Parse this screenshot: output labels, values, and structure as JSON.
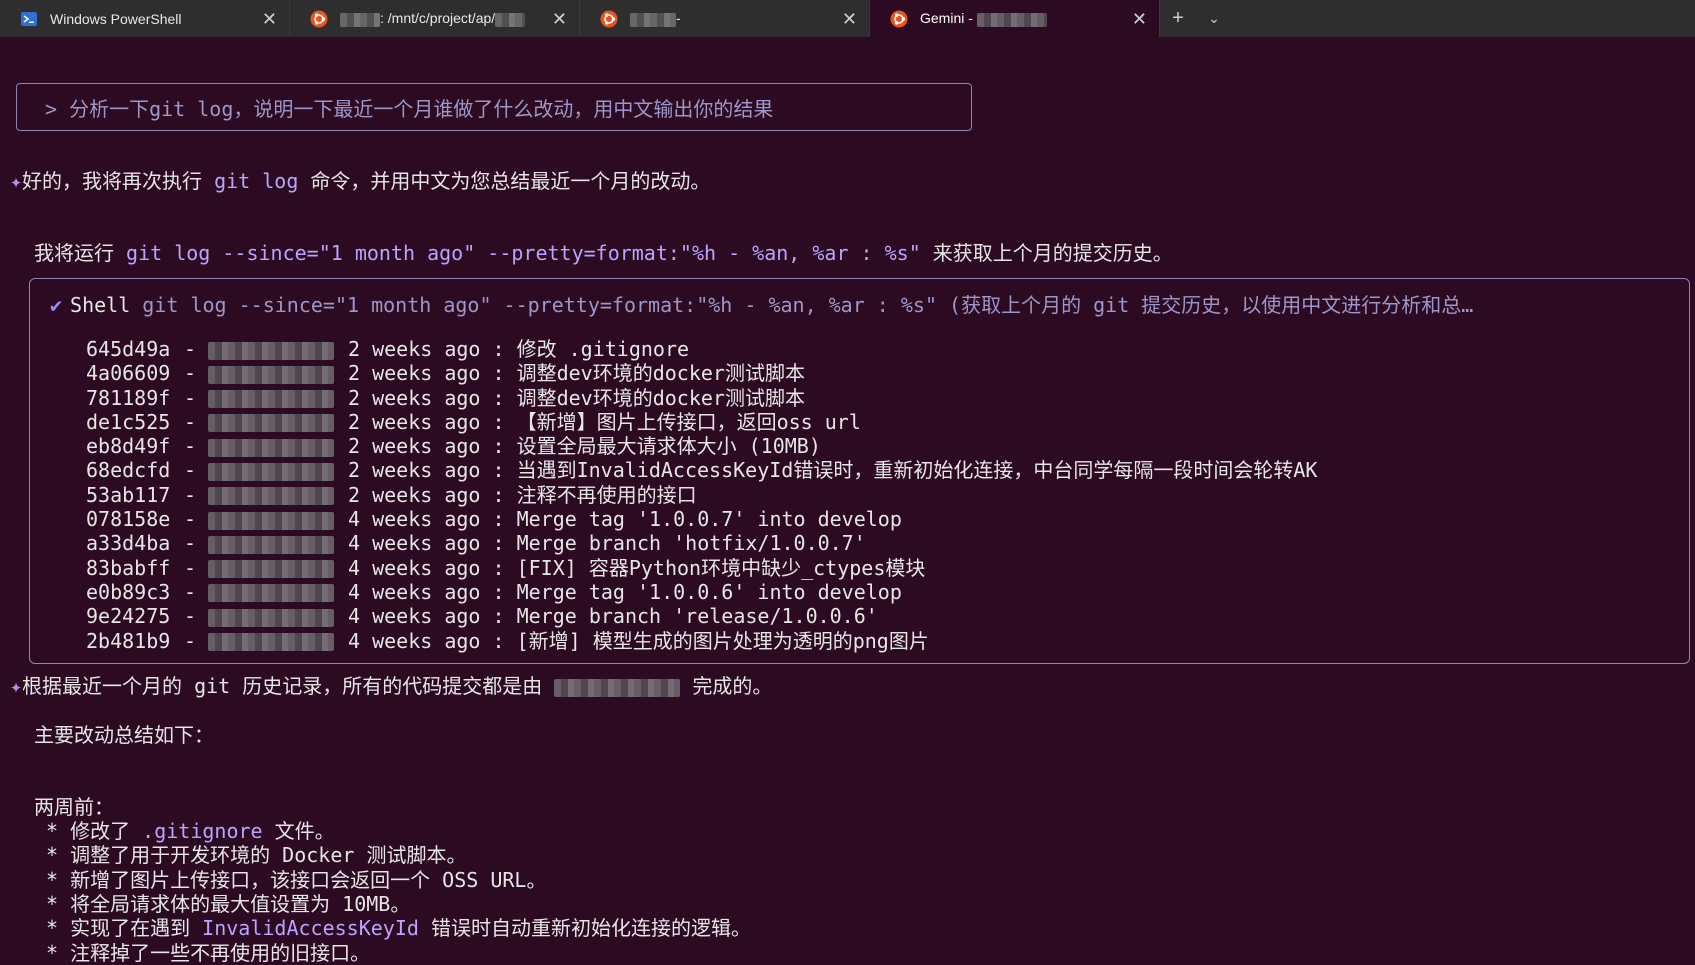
{
  "tabs": [
    {
      "title": "Windows PowerShell",
      "icon": "powershell-icon",
      "active": false
    },
    {
      "title": ": /mnt/c/project/ap/",
      "icon": "ubuntu-icon",
      "active": false,
      "redacted_prefix": true
    },
    {
      "title": "-",
      "icon": "ubuntu-icon",
      "active": false,
      "redacted_prefix": true
    },
    {
      "title": "Gemini - ",
      "icon": "ubuntu-icon",
      "active": true
    }
  ],
  "tab_controls": {
    "add": "+",
    "menu": "⌄",
    "close": "✕"
  },
  "prompt": "> 分析一下git log，说明一下最近一个月谁做了什么改动，用中文输出你的结果",
  "reply1": {
    "sparkle": "✦",
    "before": "好的，我将再次执行 ",
    "cmd": "git log",
    "after": " 命令，并用中文为您总结最近一个月的改动。"
  },
  "run_line": {
    "before": "我将运行 ",
    "cmd": "git log --since=\"1 month ago\" --pretty=format:\"%h - %an, %ar : %s\"",
    "after": " 来获取上个月的提交历史。"
  },
  "shell": {
    "check": "✔",
    "label": "Shell",
    "command": " git log --since=\"1 month ago\" --pretty=format:\"%h - %an, %ar : %s\" (获取上个月的 git 提交历史，以使用中文进行分析和总…",
    "rows": [
      {
        "hash": "645d49a",
        "time": "2 weeks ago",
        "msg": "修改 .gitignore"
      },
      {
        "hash": "4a06609",
        "time": "2 weeks ago",
        "msg": "调整dev环境的docker测试脚本"
      },
      {
        "hash": "781189f",
        "time": "2 weeks ago",
        "msg": "调整dev环境的docker测试脚本"
      },
      {
        "hash": "de1c525",
        "time": "2 weeks ago",
        "msg": "【新增】图片上传接口，返回oss url"
      },
      {
        "hash": "eb8d49f",
        "time": "2 weeks ago",
        "msg": "设置全局最大请求体大小 (10MB)"
      },
      {
        "hash": "68edcfd",
        "time": "2 weeks ago",
        "msg": "当遇到InvalidAccessKeyId错误时，重新初始化连接，中台同学每隔一段时间会轮转AK"
      },
      {
        "hash": "53ab117",
        "time": "2 weeks ago",
        "msg": "注释不再使用的接口"
      },
      {
        "hash": "078158e",
        "time": "4 weeks ago",
        "msg": "Merge tag '1.0.0.7' into develop"
      },
      {
        "hash": "a33d4ba",
        "time": "4 weeks ago",
        "msg": "Merge branch 'hotfix/1.0.0.7'"
      },
      {
        "hash": "83babff",
        "time": "4 weeks ago",
        "msg": "[FIX] 容器Python环境中缺少_ctypes模块"
      },
      {
        "hash": "e0b89c3",
        "time": "4 weeks ago",
        "msg": "Merge tag '1.0.0.6' into develop"
      },
      {
        "hash": "9e24275",
        "time": "4 weeks ago",
        "msg": "Merge branch 'release/1.0.0.6'"
      },
      {
        "hash": "2b481b9",
        "time": "4 weeks ago",
        "msg": "[新增] 模型生成的图片处理为透明的png图片"
      }
    ]
  },
  "summary": {
    "sparkle": "✦",
    "before": "根据最近一个月的 git 历史记录，所有的代码提交都是由 ",
    "after": " 完成的。",
    "heading": "主要改动总结如下：",
    "period": "两周前：",
    "bullets": [
      {
        "before": " * 修改了 ",
        "code": ".gitignore",
        "after": " 文件。"
      },
      {
        "before": " * 调整了用于开发环境的 Docker 测试脚本。",
        "code": "",
        "after": ""
      },
      {
        "before": " * 新增了图片上传接口，该接口会返回一个 OSS URL。",
        "code": "",
        "after": ""
      },
      {
        "before": " * 将全局请求体的最大值设置为 10MB。",
        "code": "",
        "after": ""
      },
      {
        "before": " * 实现了在遇到 ",
        "code": "InvalidAccessKeyId",
        "after": " 错误时自动重新初始化连接的逻辑。"
      },
      {
        "before": " * 注释掉了一些不再使用的旧接口。",
        "code": "",
        "after": ""
      }
    ]
  },
  "colors": {
    "background": "#2c0a22",
    "tabbar": "#2e2e2e",
    "accent": "#b9a4ff",
    "border": "#8d86b8"
  }
}
